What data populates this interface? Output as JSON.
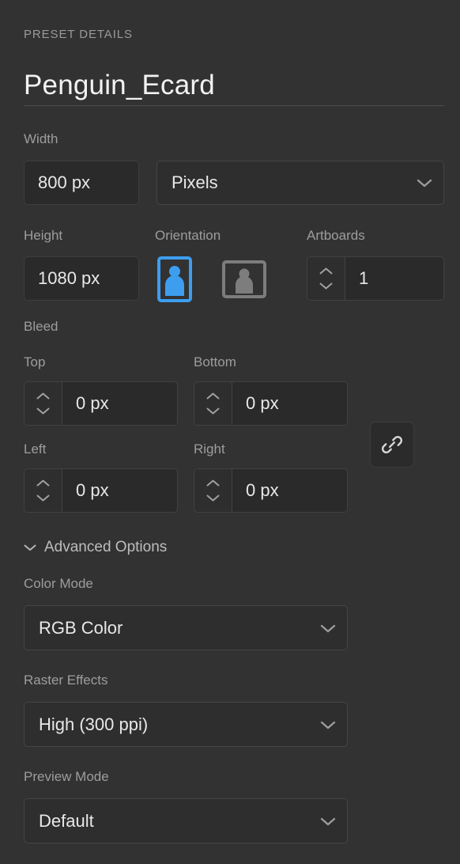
{
  "panel": {
    "section_title": "PRESET DETAILS",
    "document_name": "Penguin_Ecard"
  },
  "colors": {
    "panel_bg": "#323232",
    "input_bg": "#2a2a2a",
    "input_border": "#3e3e3e",
    "label_text": "#9d9d9d",
    "value_text": "#e8e8e8",
    "accent_blue": "#3d9eef",
    "inactive_gray": "#7d7d7d"
  },
  "size": {
    "width": {
      "label": "Width",
      "value": "800 px"
    },
    "units": {
      "value": "Pixels",
      "icon": "chevron-down-icon"
    },
    "height": {
      "label": "Height",
      "value": "1080 px"
    },
    "orientation": {
      "label": "Orientation",
      "portrait": {
        "name": "portrait",
        "selected": true
      },
      "landscape": {
        "name": "landscape",
        "selected": false
      }
    },
    "artboards": {
      "label": "Artboards",
      "value": "1"
    }
  },
  "bleed": {
    "label": "Bleed",
    "top": {
      "label": "Top",
      "value": "0 px"
    },
    "bottom": {
      "label": "Bottom",
      "value": "0 px"
    },
    "left": {
      "label": "Left",
      "value": "0 px"
    },
    "right": {
      "label": "Right",
      "value": "0 px"
    },
    "link": {
      "icon": "link-icon",
      "linked": false
    }
  },
  "advanced": {
    "label": "Advanced Options",
    "expanded": true,
    "color_mode": {
      "label": "Color Mode",
      "value": "RGB Color"
    },
    "raster_effects": {
      "label": "Raster Effects",
      "value": "High (300 ppi)"
    },
    "preview_mode": {
      "label": "Preview Mode",
      "value": "Default"
    }
  }
}
